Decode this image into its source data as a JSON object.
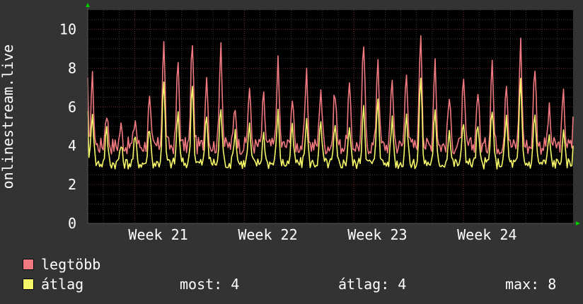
{
  "colors": {
    "background": "#333333",
    "plot_background": "#000000",
    "grid_minor": "#3a3a3a",
    "grid_major": "#6a2a2a",
    "axis_arrow": "#00cc00",
    "legtobb": "#f07a80",
    "atlag": "#f7f76a"
  },
  "chart_data": {
    "type": "line",
    "ylabel": "onlinestream.live",
    "ylim": [
      0,
      11
    ],
    "yticks": [
      0,
      2,
      4,
      6,
      8,
      10
    ],
    "xlim": [
      0,
      31
    ],
    "x_tick_labels": [
      {
        "x": 4.5,
        "label": "Week 21"
      },
      {
        "x": 11.5,
        "label": "Week 22"
      },
      {
        "x": 18.5,
        "label": "Week 23"
      },
      {
        "x": 25.5,
        "label": "Week 24"
      }
    ],
    "x_major_grid": [
      3,
      10,
      17,
      24
    ],
    "grid": true,
    "series": [
      {
        "name": "legtöbb",
        "color": "#f07a80",
        "peaks": [
          7.5,
          5.8,
          5.0,
          5.4,
          6.3,
          9.3,
          8.3,
          9.5,
          7.8,
          9.5,
          6.1,
          7.0,
          6.5,
          8.3,
          6.4,
          7.6,
          7.1,
          6.9,
          7.0,
          9.3,
          8.7,
          7.6,
          8.1,
          10.0,
          8.6,
          6.5,
          7.2,
          6.9,
          8.5,
          7.5,
          9.4,
          8.2,
          5.8,
          6.6
        ],
        "last": 5.5
      },
      {
        "name": "átlag",
        "color": "#f7f76a",
        "peaks": [
          5.8,
          4.8,
          4.0,
          4.4,
          5.0,
          7.3,
          5.7,
          7.4,
          5.6,
          6.0,
          4.8,
          5.0,
          4.6,
          5.7,
          4.9,
          5.3,
          5.1,
          4.9,
          5.0,
          6.2,
          6.6,
          5.4,
          5.6,
          7.6,
          5.7,
          4.8,
          5.3,
          5.0,
          6.0,
          5.5,
          7.3,
          5.7,
          4.4,
          4.6
        ],
        "last": 4.0
      }
    ]
  },
  "legend": [
    {
      "label": "legtöbb",
      "color": "#f07a80"
    },
    {
      "label": "átlag",
      "color": "#f7f76a"
    }
  ],
  "stats": {
    "most": "most: 4",
    "atlag": "átlag: 4",
    "max": "max: 8"
  }
}
